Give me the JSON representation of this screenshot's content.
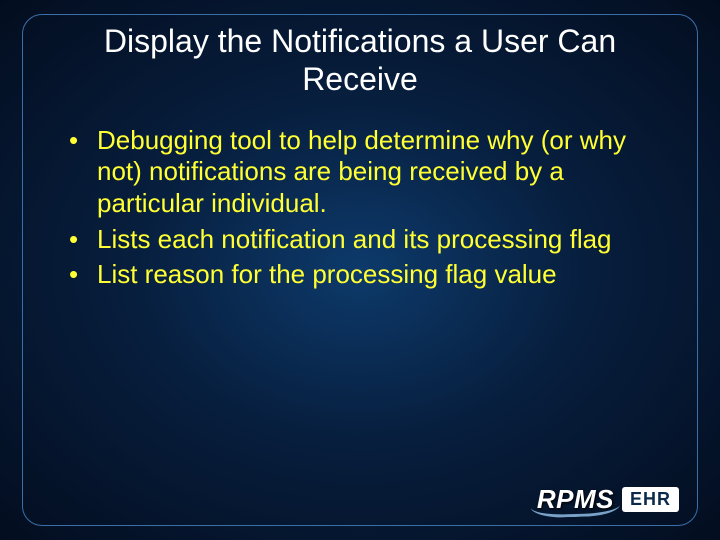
{
  "slide": {
    "title": "Display the Notifications a User Can Receive",
    "bullets": [
      "Debugging tool to help determine why (or why not) notifications are being received by a particular individual.",
      "Lists each notification and its processing flag",
      "List reason for the processing flag value"
    ]
  },
  "branding": {
    "product": "RPMS",
    "badge": "EHR"
  },
  "colors": {
    "title": "#ffffff",
    "bullet": "#ffff33",
    "frame": "#3a6fa8"
  }
}
